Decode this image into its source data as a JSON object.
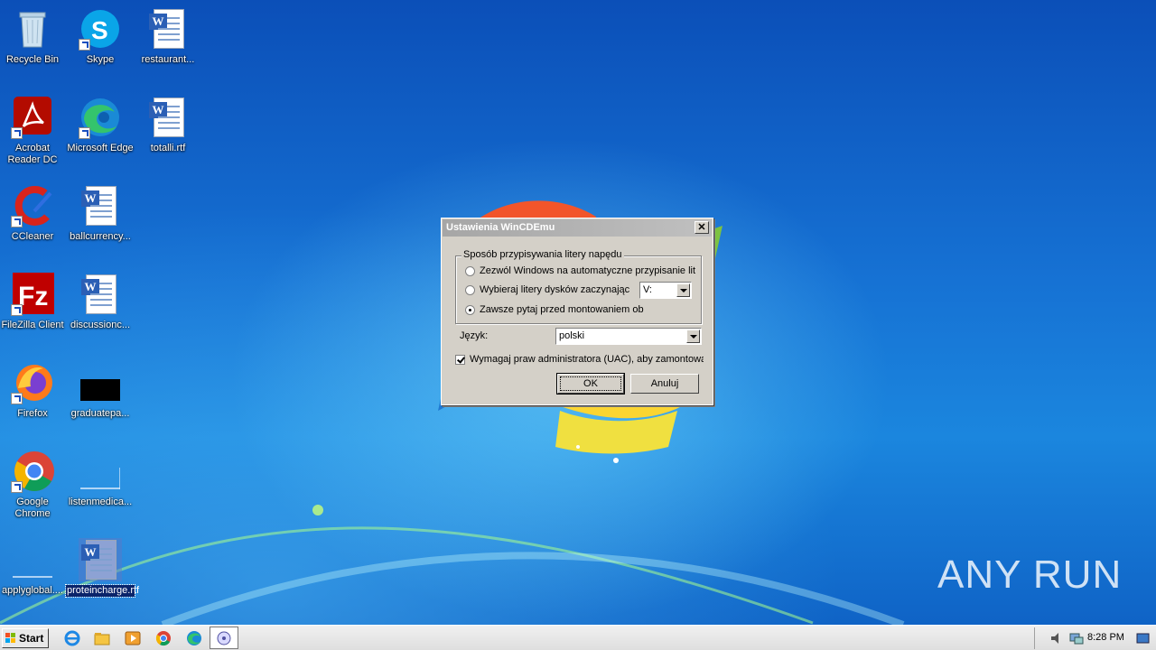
{
  "desktop": {
    "icons": [
      {
        "label": "Recycle Bin"
      },
      {
        "label": "Skype"
      },
      {
        "label": "restaurant..."
      },
      {
        "label": "Acrobat Reader DC"
      },
      {
        "label": "Microsoft Edge"
      },
      {
        "label": "totalli.rtf"
      },
      {
        "label": "CCleaner"
      },
      {
        "label": "ballcurrency..."
      },
      {
        "label": "FileZilla Client"
      },
      {
        "label": "discussionc..."
      },
      {
        "label": "Firefox"
      },
      {
        "label": "graduatepa..."
      },
      {
        "label": "Google Chrome"
      },
      {
        "label": "listenmedica..."
      },
      {
        "label": "applyglobal...."
      },
      {
        "label": "proteincharge.rtf"
      }
    ]
  },
  "dialog": {
    "title": "Ustawienia WinCDEmu",
    "close_glyph": "✕",
    "group_label": "Sposób przypisywania litery napędu",
    "radio_auto": "Zezwól Windows na automatyczne przypisanie lite",
    "radio_start": "Wybieraj litery dysków zaczynając",
    "drive_value": "V:",
    "radio_ask": "Zawsze pytaj przed montowaniem ob",
    "language_label": "Język:",
    "language_value": "polski",
    "uac_label": "Wymagaj praw administratora (UAC), aby zamontowa",
    "ok_label": "OK",
    "cancel_label": "Anuluj"
  },
  "taskbar": {
    "start_label": "Start",
    "clock": "8:28 PM"
  },
  "watermark": "ANY RUN",
  "colors": {
    "dialog_bg": "#d4d0c8",
    "titlebar_inactive": "#a6a6a6",
    "selection": "#0a246a"
  }
}
